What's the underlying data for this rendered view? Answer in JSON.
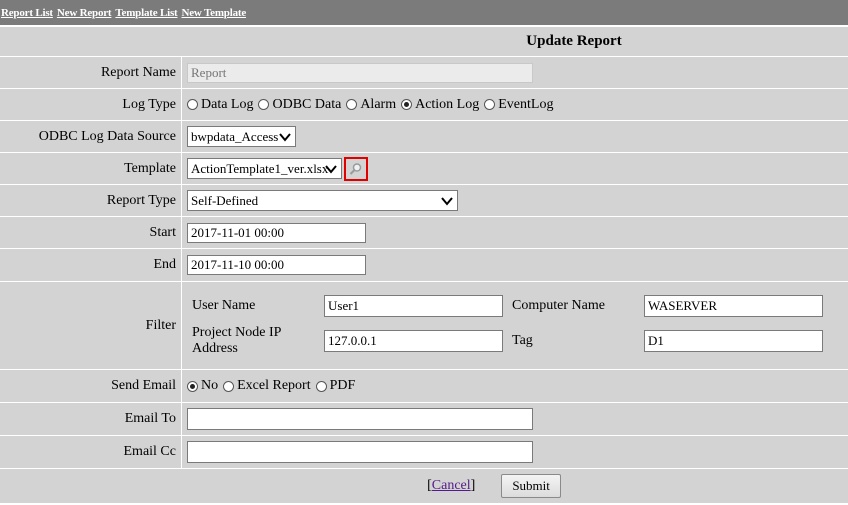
{
  "nav": {
    "links": [
      "Report List",
      "New Report",
      "Template List",
      "New Template"
    ]
  },
  "page_title": "Update Report",
  "fields": {
    "report_name": {
      "label": "Report Name",
      "placeholder": "Report",
      "value": ""
    },
    "log_type": {
      "label": "Log Type",
      "options": [
        "Data Log",
        "ODBC Data",
        "Alarm",
        "Action Log",
        "EventLog"
      ],
      "selected": "Action Log"
    },
    "odbc_source": {
      "label": "ODBC Log Data Source",
      "value": "bwpdata_Access"
    },
    "template": {
      "label": "Template",
      "value": "ActionTemplate1_ver.xlsx",
      "lookup_icon": "magnifier-icon"
    },
    "report_type": {
      "label": "Report Type",
      "value": "Self-Defined"
    },
    "start": {
      "label": "Start",
      "value": "2017-11-01 00:00"
    },
    "end": {
      "label": "End",
      "value": "2017-11-10 00:00"
    },
    "filter": {
      "label": "Filter",
      "user_name": {
        "label": "User Name",
        "value": "User1"
      },
      "computer_name": {
        "label": "Computer Name",
        "value": "WASERVER"
      },
      "project_node_ip": {
        "label": "Project Node IP Address",
        "value": "127.0.0.1"
      },
      "tag": {
        "label": "Tag",
        "value": "D1"
      }
    },
    "send_email": {
      "label": "Send Email",
      "options": [
        "No",
        "Excel Report",
        "PDF"
      ],
      "selected": "No"
    },
    "email_to": {
      "label": "Email To",
      "value": ""
    },
    "email_cc": {
      "label": "Email Cc",
      "value": ""
    }
  },
  "actions": {
    "cancel_label": "Cancel",
    "cancel_open": "[",
    "cancel_close": "]",
    "submit_label": "Submit"
  },
  "colors": {
    "topbar": "#7b7b7b",
    "form_bg": "#d3d3d3",
    "highlight_box": "#e00000"
  }
}
